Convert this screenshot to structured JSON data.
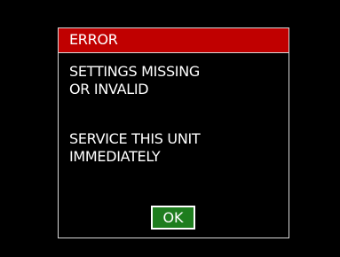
{
  "dialog": {
    "title": "ERROR",
    "message_lines": [
      "SETTINGS MISSING",
      "OR INVALID",
      "SERVICE THIS UNIT",
      "IMMEDIATELY"
    ],
    "ok_label": "OK"
  },
  "colors": {
    "background": "#000000",
    "title_bar": "#c00000",
    "ok_button": "#1e7d1e",
    "text": "#ffffff",
    "border": "#d9d9d9"
  }
}
